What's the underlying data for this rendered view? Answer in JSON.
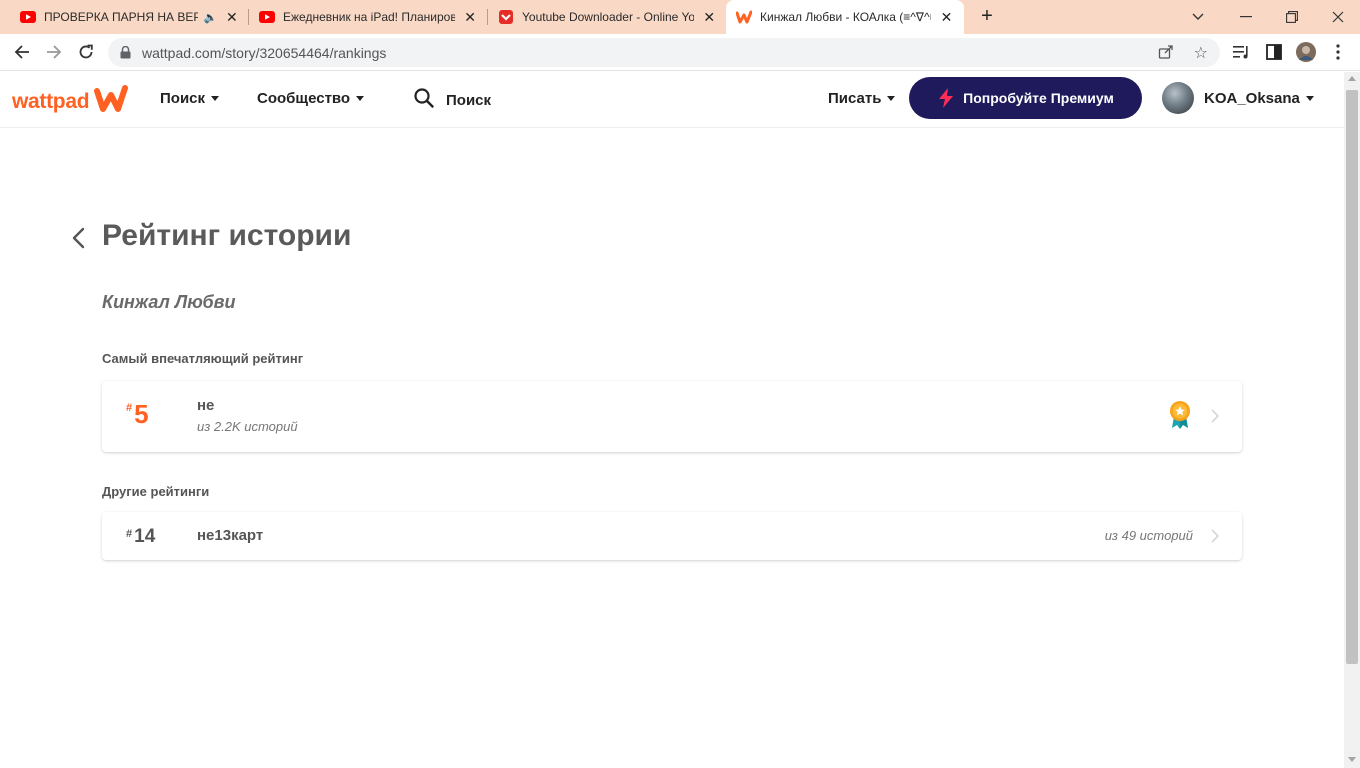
{
  "browser": {
    "tabs": [
      {
        "title": "ПРОВЕРКА ПАРНЯ НА ВЕРНОСТЬ",
        "icon": "youtube-icon",
        "audio": true,
        "active": false
      },
      {
        "title": "Ежедневник на iPad! Планирование",
        "icon": "youtube-icon",
        "audio": false,
        "active": false
      },
      {
        "title": "Youtube Downloader - Online Youtube",
        "icon": "downloader-icon",
        "audio": false,
        "active": false
      },
      {
        "title": "Кинжал Любви - КОАлка (≡^∇^≡)",
        "icon": "wattpad-icon",
        "audio": false,
        "active": true
      }
    ],
    "address": "wattpad.com/story/320654464/rankings"
  },
  "header": {
    "logo_text": "wattpad",
    "nav_browse": "Поиск",
    "nav_community": "Сообщество",
    "search_label": "Поиск",
    "write_label": "Писать",
    "premium_label": "Попробуйте Премиум",
    "username": "KOA_Oksana"
  },
  "page": {
    "title": "Рейтинг истории",
    "story_title": "Кинжал Любви",
    "best_label": "Самый впечатляющий рейтинг",
    "best": {
      "hash": "#",
      "rank": "5",
      "tag": "не",
      "sub": "из 2.2K историй"
    },
    "other_label": "Другие рейтинги",
    "others": [
      {
        "hash": "#",
        "rank": "14",
        "tag": "не13карт",
        "sub": "из 49 историй"
      }
    ]
  },
  "colors": {
    "brand": "#ff6122",
    "premium_bg": "#1f1a5c",
    "tabstrip_bg": "#f9d9c6"
  }
}
